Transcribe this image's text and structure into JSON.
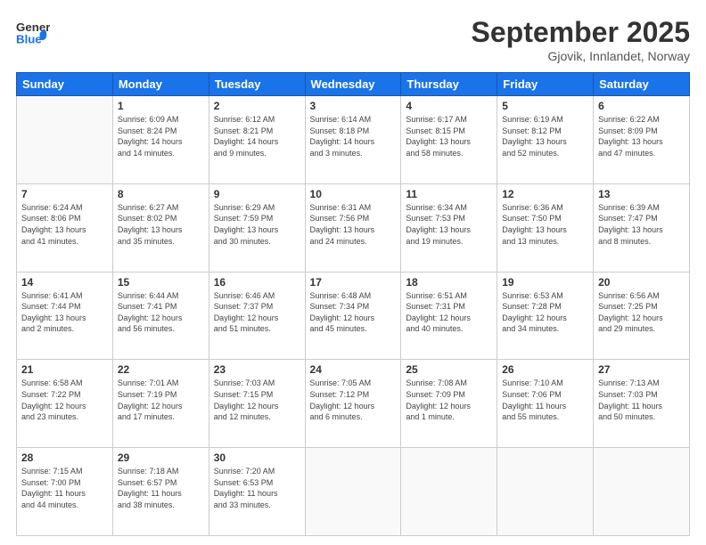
{
  "logo": {
    "general": "General",
    "blue": "Blue"
  },
  "header": {
    "title": "September 2025",
    "subtitle": "Gjovik, Innlandet, Norway"
  },
  "days_of_week": [
    "Sunday",
    "Monday",
    "Tuesday",
    "Wednesday",
    "Thursday",
    "Friday",
    "Saturday"
  ],
  "weeks": [
    [
      {
        "day": "",
        "info": ""
      },
      {
        "day": "1",
        "info": "Sunrise: 6:09 AM\nSunset: 8:24 PM\nDaylight: 14 hours\nand 14 minutes."
      },
      {
        "day": "2",
        "info": "Sunrise: 6:12 AM\nSunset: 8:21 PM\nDaylight: 14 hours\nand 9 minutes."
      },
      {
        "day": "3",
        "info": "Sunrise: 6:14 AM\nSunset: 8:18 PM\nDaylight: 14 hours\nand 3 minutes."
      },
      {
        "day": "4",
        "info": "Sunrise: 6:17 AM\nSunset: 8:15 PM\nDaylight: 13 hours\nand 58 minutes."
      },
      {
        "day": "5",
        "info": "Sunrise: 6:19 AM\nSunset: 8:12 PM\nDaylight: 13 hours\nand 52 minutes."
      },
      {
        "day": "6",
        "info": "Sunrise: 6:22 AM\nSunset: 8:09 PM\nDaylight: 13 hours\nand 47 minutes."
      }
    ],
    [
      {
        "day": "7",
        "info": "Sunrise: 6:24 AM\nSunset: 8:06 PM\nDaylight: 13 hours\nand 41 minutes."
      },
      {
        "day": "8",
        "info": "Sunrise: 6:27 AM\nSunset: 8:02 PM\nDaylight: 13 hours\nand 35 minutes."
      },
      {
        "day": "9",
        "info": "Sunrise: 6:29 AM\nSunset: 7:59 PM\nDaylight: 13 hours\nand 30 minutes."
      },
      {
        "day": "10",
        "info": "Sunrise: 6:31 AM\nSunset: 7:56 PM\nDaylight: 13 hours\nand 24 minutes."
      },
      {
        "day": "11",
        "info": "Sunrise: 6:34 AM\nSunset: 7:53 PM\nDaylight: 13 hours\nand 19 minutes."
      },
      {
        "day": "12",
        "info": "Sunrise: 6:36 AM\nSunset: 7:50 PM\nDaylight: 13 hours\nand 13 minutes."
      },
      {
        "day": "13",
        "info": "Sunrise: 6:39 AM\nSunset: 7:47 PM\nDaylight: 13 hours\nand 8 minutes."
      }
    ],
    [
      {
        "day": "14",
        "info": "Sunrise: 6:41 AM\nSunset: 7:44 PM\nDaylight: 13 hours\nand 2 minutes."
      },
      {
        "day": "15",
        "info": "Sunrise: 6:44 AM\nSunset: 7:41 PM\nDaylight: 12 hours\nand 56 minutes."
      },
      {
        "day": "16",
        "info": "Sunrise: 6:46 AM\nSunset: 7:37 PM\nDaylight: 12 hours\nand 51 minutes."
      },
      {
        "day": "17",
        "info": "Sunrise: 6:48 AM\nSunset: 7:34 PM\nDaylight: 12 hours\nand 45 minutes."
      },
      {
        "day": "18",
        "info": "Sunrise: 6:51 AM\nSunset: 7:31 PM\nDaylight: 12 hours\nand 40 minutes."
      },
      {
        "day": "19",
        "info": "Sunrise: 6:53 AM\nSunset: 7:28 PM\nDaylight: 12 hours\nand 34 minutes."
      },
      {
        "day": "20",
        "info": "Sunrise: 6:56 AM\nSunset: 7:25 PM\nDaylight: 12 hours\nand 29 minutes."
      }
    ],
    [
      {
        "day": "21",
        "info": "Sunrise: 6:58 AM\nSunset: 7:22 PM\nDaylight: 12 hours\nand 23 minutes."
      },
      {
        "day": "22",
        "info": "Sunrise: 7:01 AM\nSunset: 7:19 PM\nDaylight: 12 hours\nand 17 minutes."
      },
      {
        "day": "23",
        "info": "Sunrise: 7:03 AM\nSunset: 7:15 PM\nDaylight: 12 hours\nand 12 minutes."
      },
      {
        "day": "24",
        "info": "Sunrise: 7:05 AM\nSunset: 7:12 PM\nDaylight: 12 hours\nand 6 minutes."
      },
      {
        "day": "25",
        "info": "Sunrise: 7:08 AM\nSunset: 7:09 PM\nDaylight: 12 hours\nand 1 minute."
      },
      {
        "day": "26",
        "info": "Sunrise: 7:10 AM\nSunset: 7:06 PM\nDaylight: 11 hours\nand 55 minutes."
      },
      {
        "day": "27",
        "info": "Sunrise: 7:13 AM\nSunset: 7:03 PM\nDaylight: 11 hours\nand 50 minutes."
      }
    ],
    [
      {
        "day": "28",
        "info": "Sunrise: 7:15 AM\nSunset: 7:00 PM\nDaylight: 11 hours\nand 44 minutes."
      },
      {
        "day": "29",
        "info": "Sunrise: 7:18 AM\nSunset: 6:57 PM\nDaylight: 11 hours\nand 38 minutes."
      },
      {
        "day": "30",
        "info": "Sunrise: 7:20 AM\nSunset: 6:53 PM\nDaylight: 11 hours\nand 33 minutes."
      },
      {
        "day": "",
        "info": ""
      },
      {
        "day": "",
        "info": ""
      },
      {
        "day": "",
        "info": ""
      },
      {
        "day": "",
        "info": ""
      }
    ]
  ]
}
